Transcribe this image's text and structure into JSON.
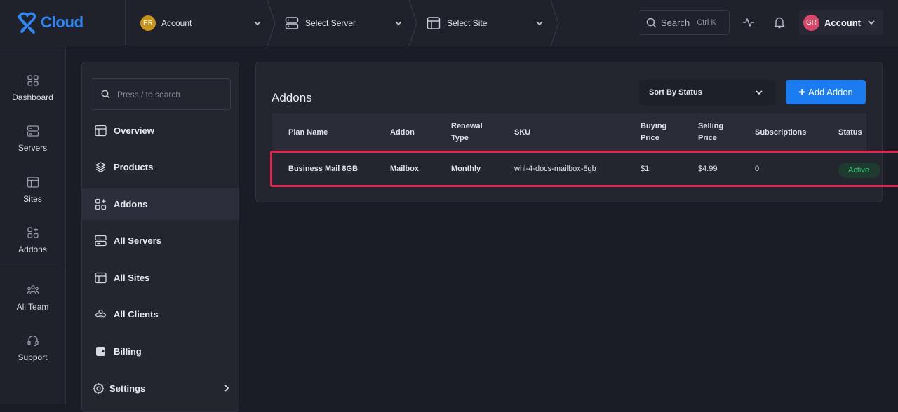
{
  "brand": {
    "logo_text": "Cloud",
    "accent": "#1a7cf0"
  },
  "topbar": {
    "account_crumb": {
      "initials": "ER",
      "label": "Account",
      "avatar_color": "#c8941a"
    },
    "server_crumb": {
      "label": "Select Server"
    },
    "site_crumb": {
      "label": "Select Site"
    },
    "search": {
      "label": "Search",
      "shortcut": "Ctrl K"
    },
    "account_menu": {
      "initials": "GR",
      "label": "Account",
      "avatar_color": "#d9476b"
    }
  },
  "rail": {
    "items": [
      {
        "label": "Dashboard",
        "icon": "dashboard-icon"
      },
      {
        "label": "Servers",
        "icon": "servers-icon"
      },
      {
        "label": "Sites",
        "icon": "sites-icon"
      },
      {
        "label": "Addons",
        "icon": "addons-icon"
      },
      {
        "label": "All Team",
        "icon": "team-icon"
      },
      {
        "label": "Support",
        "icon": "support-icon"
      }
    ]
  },
  "subnav": {
    "search_placeholder": "Press / to search",
    "items": [
      {
        "label": "Overview",
        "icon": "overview-icon"
      },
      {
        "label": "Products",
        "icon": "products-icon"
      },
      {
        "label": "Addons",
        "icon": "addons-icon",
        "active": true
      },
      {
        "label": "All Servers",
        "icon": "servers-icon"
      },
      {
        "label": "All Sites",
        "icon": "sites-icon"
      },
      {
        "label": "All Clients",
        "icon": "clients-icon"
      },
      {
        "label": "Billing",
        "icon": "billing-icon"
      },
      {
        "label": "Settings",
        "icon": "gear-icon"
      }
    ]
  },
  "main": {
    "title": "Addons",
    "sort_label": "Sort By Status",
    "add_button_label": "Add Addon",
    "table": {
      "headers": {
        "plan_name": "Plan Name",
        "addon": "Addon",
        "renewal_1": "Renewal",
        "renewal_2": "Type",
        "sku": "SKU",
        "buying_1": "Buying",
        "buying_2": "Price",
        "selling_1": "Selling",
        "selling_2": "Price",
        "subscriptions": "Subscriptions",
        "status": "Status"
      },
      "rows": [
        {
          "plan_name": "Business Mail 8GB",
          "addon": "Mailbox",
          "renewal_type": "Monthly",
          "sku": "whl-4-docs-mailbox-8gb",
          "buying_price": "$1",
          "selling_price": "$4.99",
          "subscriptions": "0",
          "status": "Active"
        }
      ]
    }
  }
}
